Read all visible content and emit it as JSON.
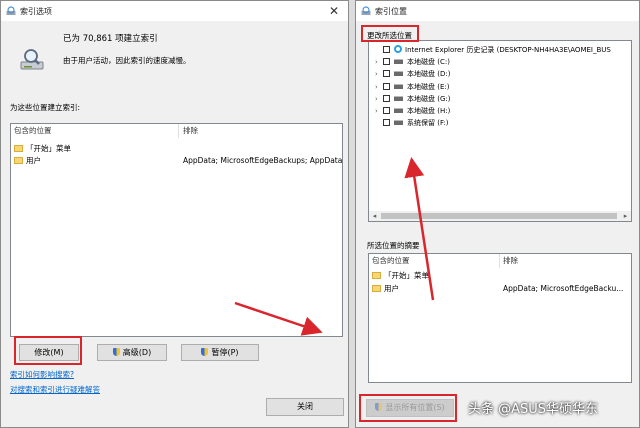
{
  "left_window": {
    "title": "索引选项",
    "indexed_count": "已为 70,861 项建立索引",
    "status_message": "由于用户活动，因此索引的速度减慢。",
    "section_label": "为这些位置建立索引:",
    "table": {
      "col_included": "包含的位置",
      "col_exclude": "排除",
      "rows": [
        {
          "location": "「开始」菜单",
          "exclude": ""
        },
        {
          "location": "用户",
          "exclude": "AppData; MicrosoftEdgeBackups; AppData"
        }
      ]
    },
    "buttons": {
      "modify": "修改(M)",
      "advanced": "高级(D)",
      "pause": "暂停(P)",
      "close": "关闭"
    },
    "links": {
      "how_indexing": "索引如何影响搜索?",
      "troubleshoot": "对搜索和索引进行疑难解答"
    }
  },
  "right_window": {
    "title": "索引位置",
    "change_label": "更改所选位置",
    "tree": [
      {
        "label": "Internet Explorer 历史记录 (DESKTOP-NH4HA3E\\AOMEI_BUS",
        "icon": "internet-explorer-icon",
        "expandable": false
      },
      {
        "label": "本地磁盘 (C:)",
        "icon": "drive-icon",
        "expandable": true
      },
      {
        "label": "本地磁盘 (D:)",
        "icon": "drive-icon",
        "expandable": true
      },
      {
        "label": "本地磁盘 (E:)",
        "icon": "drive-icon",
        "expandable": true
      },
      {
        "label": "本地磁盘 (G:)",
        "icon": "drive-icon",
        "expandable": true
      },
      {
        "label": "本地磁盘 (H:)",
        "icon": "drive-icon",
        "expandable": true
      },
      {
        "label": "系统保留 (F:)",
        "icon": "drive-icon",
        "expandable": false
      }
    ],
    "summary_label": "所选位置的摘要",
    "table": {
      "col_included": "包含的位置",
      "col_exclude": "排除",
      "rows": [
        {
          "location": "「开始」菜单",
          "exclude": ""
        },
        {
          "location": "用户",
          "exclude": "AppData; MicrosoftEdgeBacku..."
        }
      ]
    },
    "show_all_button": "显示所有位置(S)"
  },
  "watermark": "头条 @ASUS华硕华东",
  "colors": {
    "annotation_red": "#d9262c",
    "link_blue": "#0066cc"
  }
}
